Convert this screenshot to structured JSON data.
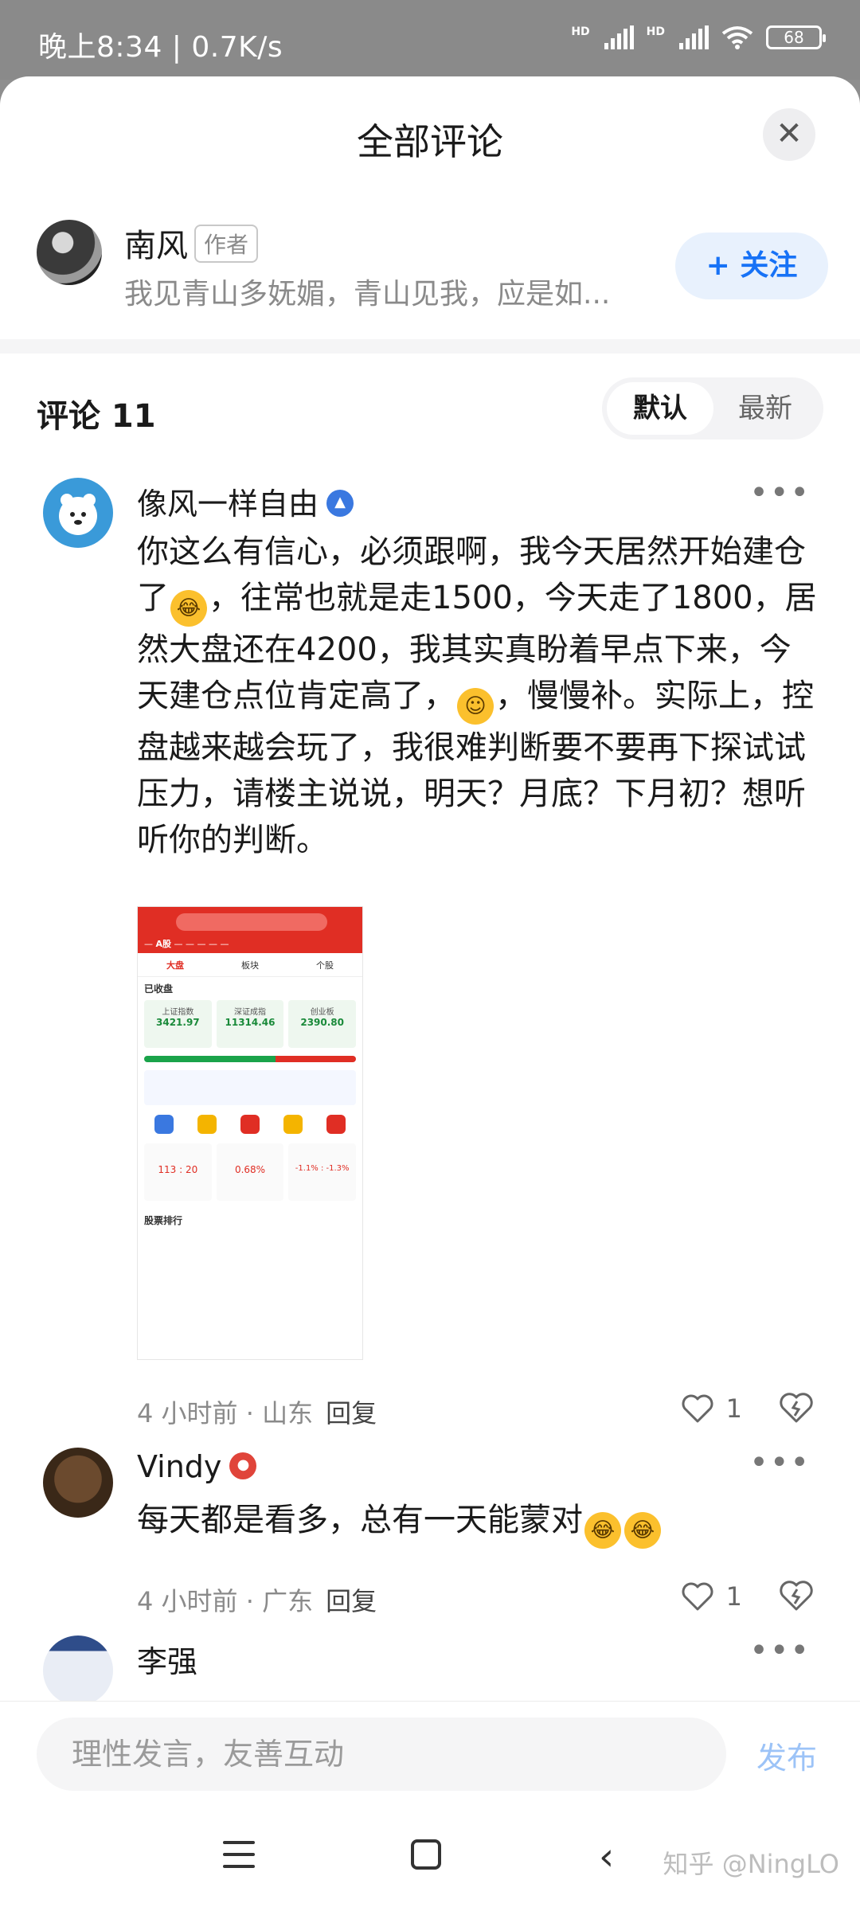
{
  "status_bar": {
    "time": "晚上8:34",
    "speed": "0.7K/s",
    "battery": "68",
    "net1": "HD",
    "net2": "HD"
  },
  "sheet": {
    "title": "全部评论",
    "close_icon": "close-icon"
  },
  "author": {
    "name": "南风",
    "tag": "作者",
    "desc": "我见青山多妩媚，青山见我，应是如...",
    "follow_label": "+ 关注"
  },
  "comments_header": {
    "title": "评论 11",
    "sort_default": "默认",
    "sort_latest": "最新"
  },
  "comments": [
    {
      "name": "像风一样自由",
      "text_1": "你这么有信心，必须跟啊，我今天居然开始建仓了",
      "text_2": "，往常也就是走1500，今天走了1800，居然大盘还在4200，我其实真盼着早点下来，今天建仓点位肯定高了，",
      "text_3": "，慢慢补。实际上，控盘越来越会玩了，我很难判断要不要再下探试试压力，请楼主说说，明天？月底？下月初？想听听你的判断。",
      "time": "4 小时前",
      "location": "山东",
      "reply": "回复",
      "likes": "1"
    },
    {
      "name": "Vindy",
      "text": "每天都是看多，总有一天能蒙对",
      "time": "4 小时前",
      "location": "广东",
      "reply": "回复",
      "likes": "1"
    },
    {
      "name": "李强"
    }
  ],
  "thumbnail": {
    "tab_a": "A股",
    "sub_1": "大盘",
    "sub_2": "板块",
    "sub_3": "个股",
    "closed": "已收盘",
    "idx1_name": "上证指数",
    "idx1_value": "3421.97",
    "idx2_name": "深证成指",
    "idx2_value": "11314.46",
    "idx3_name": "创业板",
    "idx3_value": "2390.80",
    "stat1": "113 : 20",
    "stat2": "0.68%",
    "stat3": "-1.1% : -1.3%",
    "rank": "股票排行"
  },
  "input": {
    "placeholder": "理性发言，友善互动",
    "publish": "发布"
  },
  "watermark": "知乎 @NingLO",
  "colors": {
    "accent": "#1772f6",
    "publish_disabled": "#9cc3f7",
    "thumb_red": "#e02e24"
  }
}
